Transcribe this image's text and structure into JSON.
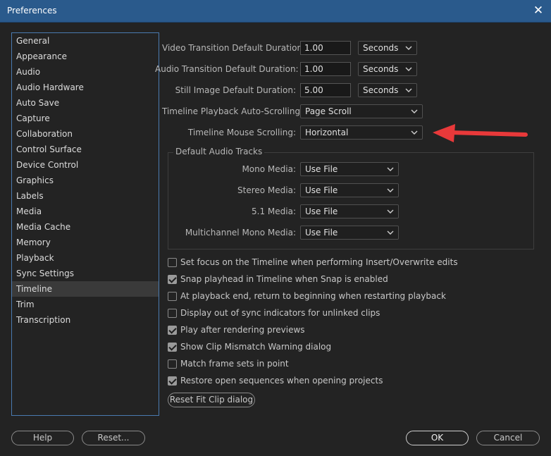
{
  "window": {
    "title": "Preferences",
    "close_glyph": "✕"
  },
  "sidebar": {
    "items": [
      {
        "label": "General"
      },
      {
        "label": "Appearance"
      },
      {
        "label": "Audio"
      },
      {
        "label": "Audio Hardware"
      },
      {
        "label": "Auto Save"
      },
      {
        "label": "Capture"
      },
      {
        "label": "Collaboration"
      },
      {
        "label": "Control Surface"
      },
      {
        "label": "Device Control"
      },
      {
        "label": "Graphics"
      },
      {
        "label": "Labels"
      },
      {
        "label": "Media"
      },
      {
        "label": "Media Cache"
      },
      {
        "label": "Memory"
      },
      {
        "label": "Playback"
      },
      {
        "label": "Sync Settings"
      },
      {
        "label": "Timeline"
      },
      {
        "label": "Trim"
      },
      {
        "label": "Transcription"
      }
    ],
    "selected": "Timeline"
  },
  "durations": {
    "video": {
      "label": "Video Transition Default Duration:",
      "value": "1.00",
      "unit": "Seconds"
    },
    "audio": {
      "label": "Audio Transition Default Duration:",
      "value": "1.00",
      "unit": "Seconds"
    },
    "still": {
      "label": "Still Image Default Duration:",
      "value": "5.00",
      "unit": "Seconds"
    }
  },
  "playback_scroll": {
    "label": "Timeline Playback Auto-Scrolling:",
    "value": "Page Scroll"
  },
  "mouse_scroll": {
    "label": "Timeline Mouse Scrolling:",
    "value": "Horizontal"
  },
  "audio_tracks": {
    "title": "Default Audio Tracks",
    "mono": {
      "label": "Mono Media:",
      "value": "Use File"
    },
    "stereo": {
      "label": "Stereo Media:",
      "value": "Use File"
    },
    "five_one": {
      "label": "5.1 Media:",
      "value": "Use File"
    },
    "multi": {
      "label": "Multichannel Mono Media:",
      "value": "Use File"
    }
  },
  "checkboxes": [
    {
      "label": "Set focus on the Timeline when performing Insert/Overwrite edits",
      "checked": false
    },
    {
      "label": "Snap playhead in Timeline when Snap is enabled",
      "checked": true
    },
    {
      "label": "At playback end, return to beginning when restarting playback",
      "checked": false
    },
    {
      "label": "Display out of sync indicators for unlinked clips",
      "checked": false
    },
    {
      "label": "Play after rendering previews",
      "checked": true
    },
    {
      "label": "Show Clip Mismatch Warning dialog",
      "checked": true
    },
    {
      "label": "Match frame sets in point",
      "checked": false
    },
    {
      "label": "Restore open sequences when opening projects",
      "checked": true
    }
  ],
  "reset_fit": "Reset Fit Clip dialog",
  "footer": {
    "help": "Help",
    "reset": "Reset...",
    "ok": "OK",
    "cancel": "Cancel"
  },
  "colors": {
    "titlebar": "#2a5a8c",
    "annotation_arrow": "#e8393a",
    "selection_border": "#4a7ab0"
  }
}
